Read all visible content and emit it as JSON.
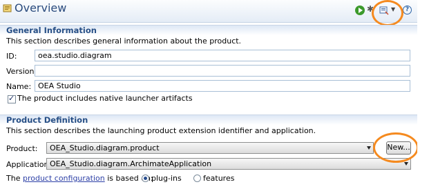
{
  "header": {
    "title": "Overview",
    "icons": [
      "overview-icon",
      "run-icon",
      "debug-icon",
      "export-icon",
      "dropdown-icon",
      "help-icon"
    ],
    "accent": "#2b4c7e"
  },
  "general": {
    "title": "General Information",
    "description": "This section describes general information about the product.",
    "id_label": "ID:",
    "id_value": "oea.studio.diagram",
    "version_label": "Version:",
    "version_value": "",
    "name_label": "Name:",
    "name_value": "OEA Studio",
    "launcher_checkbox_label": "The product includes native launcher artifacts",
    "launcher_checked": true
  },
  "definition": {
    "title": "Product Definition",
    "description": "This section describes the launching product extension identifier and application.",
    "product_label": "Product:",
    "product_value": "OEA_Studio.diagram.product",
    "new_button": "New...",
    "application_label": "Application:",
    "application_value": "OEA_Studio.diagram.ArchimateApplication",
    "config_prefix": "The",
    "config_link": "product configuration",
    "config_suffix": "is based on:",
    "options": [
      {
        "label": "plug-ins",
        "selected": true
      },
      {
        "label": "features",
        "selected": false
      }
    ]
  },
  "highlight_color": "#f58a1f"
}
